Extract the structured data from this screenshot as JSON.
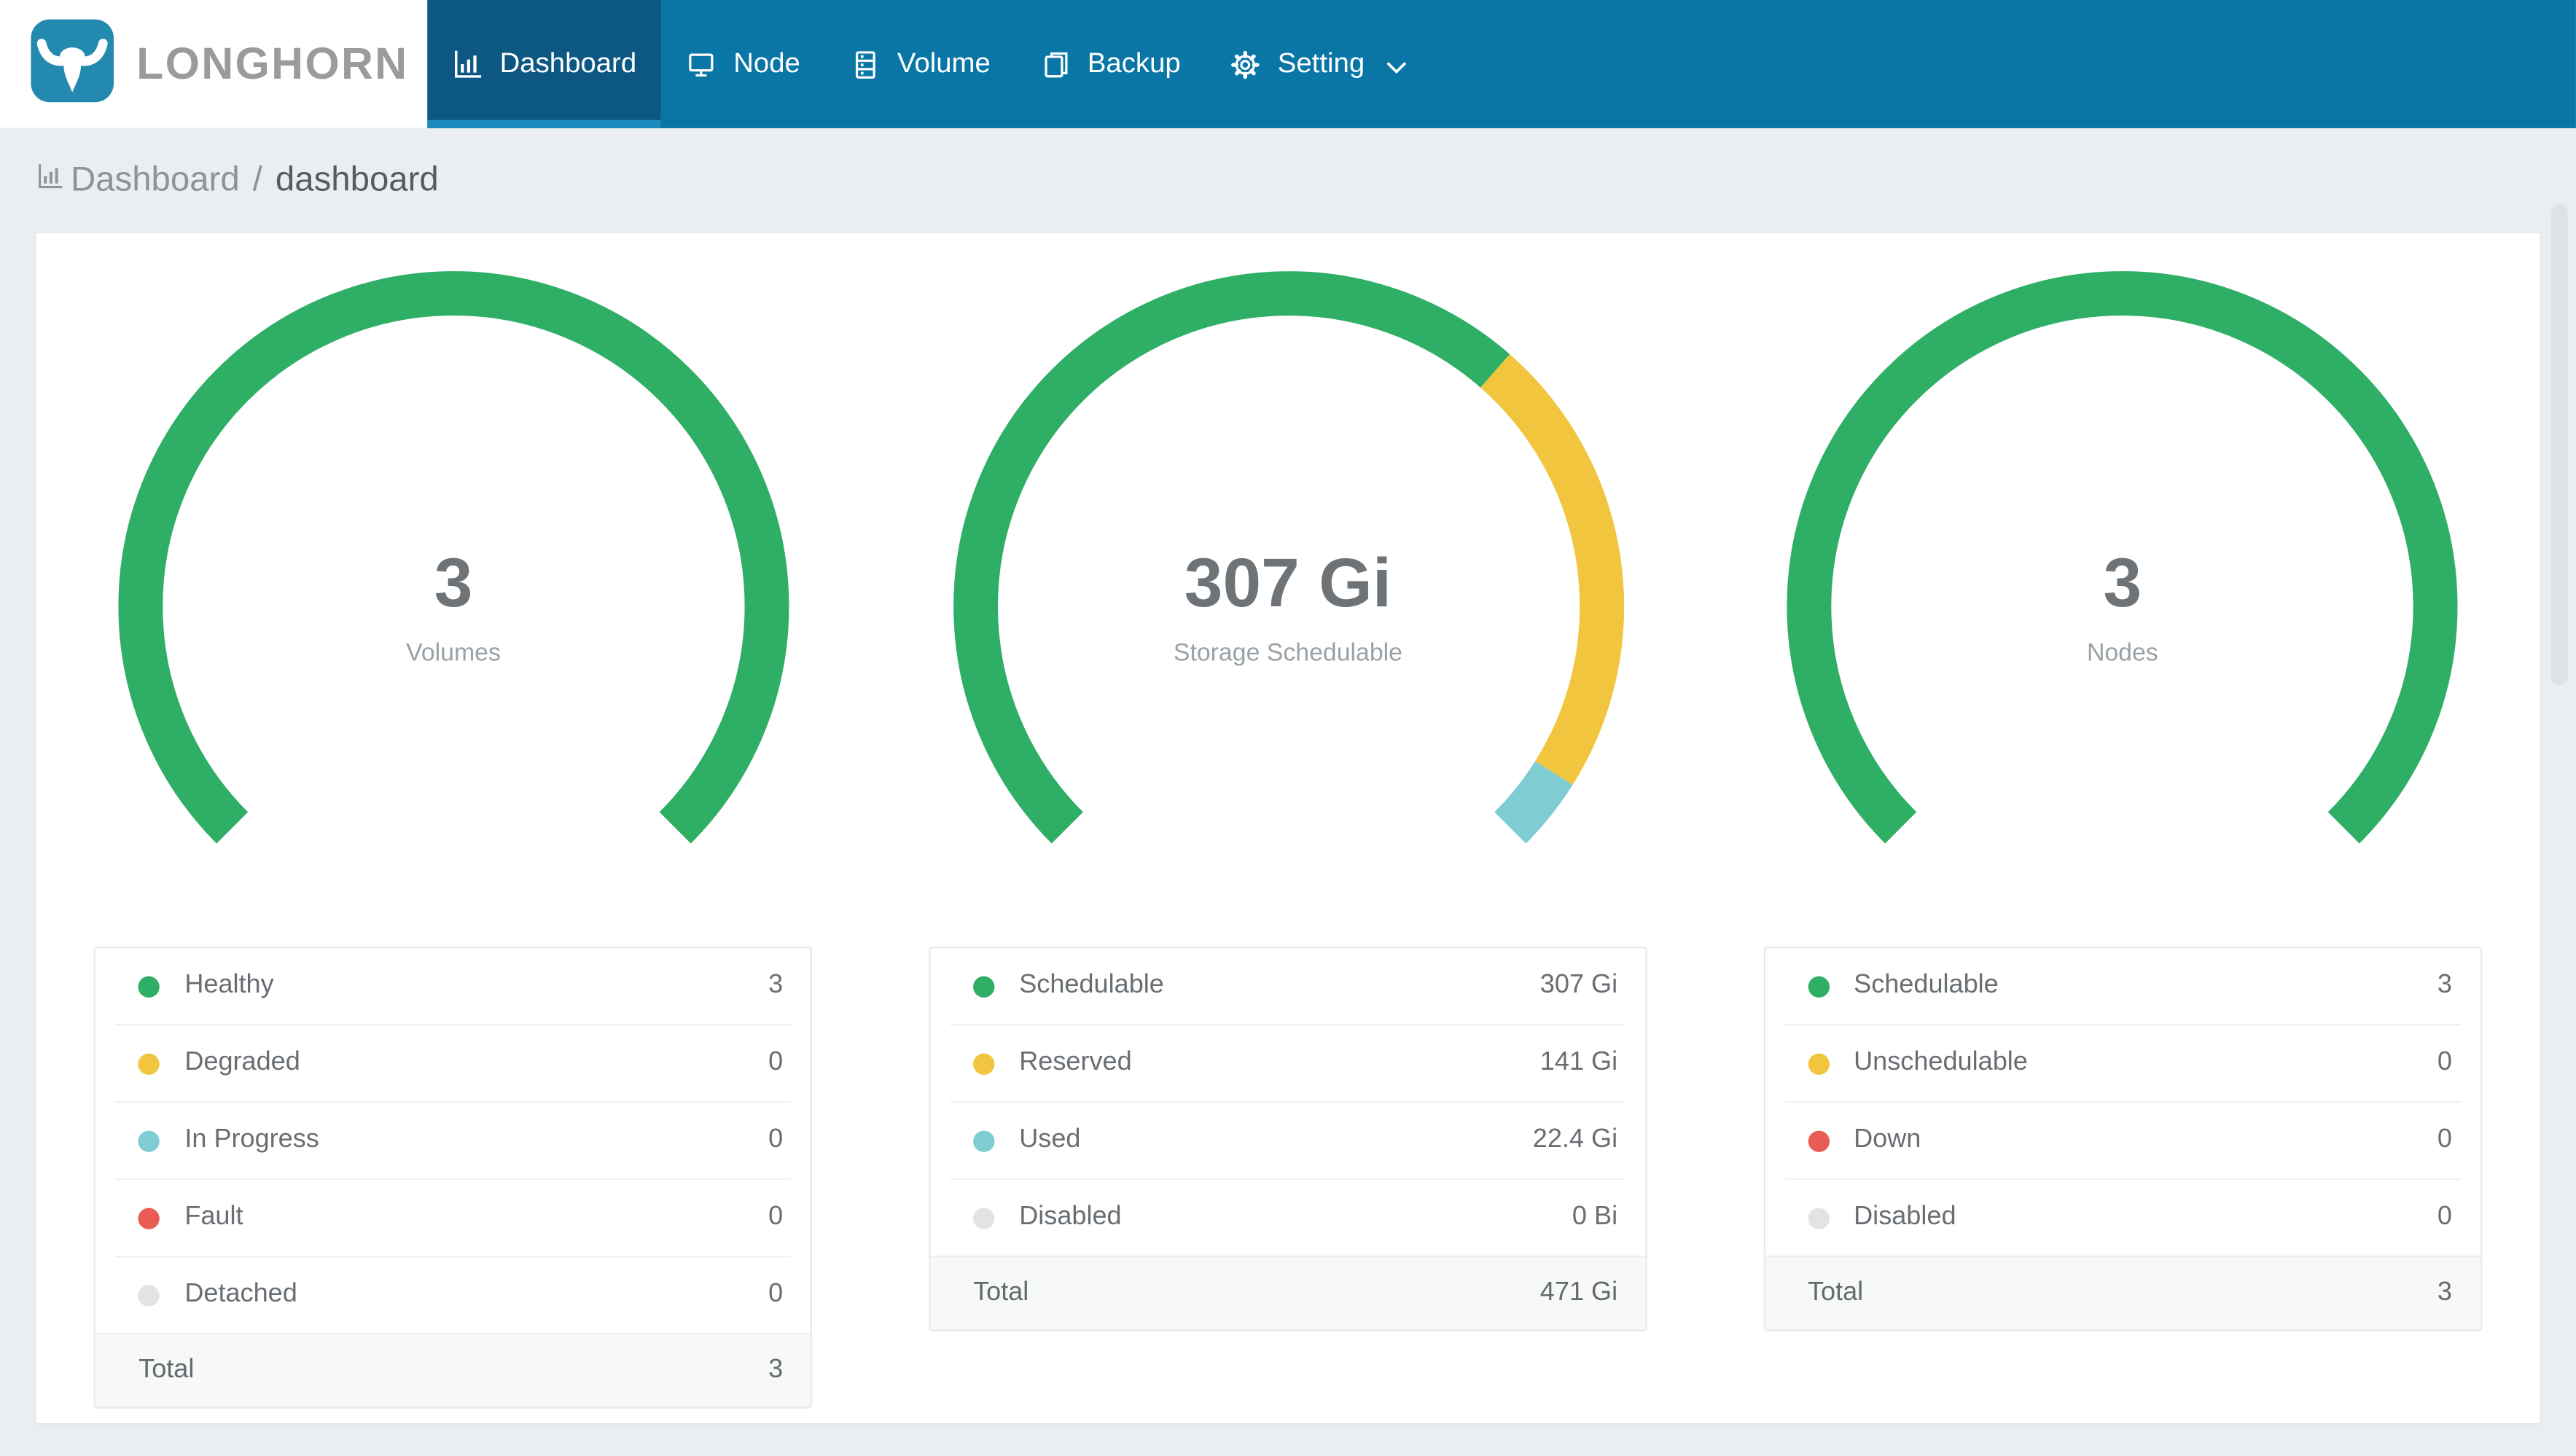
{
  "app": {
    "brand": "LONGHORN"
  },
  "nav": {
    "items": [
      {
        "label": "Dashboard",
        "icon": "dashboard-icon",
        "active": true
      },
      {
        "label": "Node",
        "icon": "node-icon",
        "active": false
      },
      {
        "label": "Volume",
        "icon": "volume-icon",
        "active": false
      },
      {
        "label": "Backup",
        "icon": "backup-icon",
        "active": false
      },
      {
        "label": "Setting",
        "icon": "setting-icon",
        "active": false,
        "dropdown": true
      }
    ]
  },
  "breadcrumb": {
    "root": "Dashboard",
    "separator": "/",
    "current": "dashboard"
  },
  "colors": {
    "navbar": "#0a76a6",
    "navbar_active_tab": "#0d5882",
    "navbar_active_underline": "#1b8cbd",
    "logo_square": "#2489ae",
    "brand_text": "#9b9b9b",
    "page_background": "#ebeef0",
    "card_background": "#ffffff",
    "green": "#2fae66",
    "yellow": "#f1c53e",
    "teal": "#7fccd2",
    "red": "#e95c55",
    "gray": "#e1e3e4"
  },
  "chart_data": [
    {
      "type": "gauge",
      "center_value": "3",
      "center_label": "Volumes",
      "start_angle": 225,
      "end_angle": -45,
      "rows": [
        {
          "label": "Healthy",
          "value": 3,
          "display": "3",
          "color": "#2fae66"
        },
        {
          "label": "Degraded",
          "value": 0,
          "display": "0",
          "color": "#f1c53e"
        },
        {
          "label": "In Progress",
          "value": 0,
          "display": "0",
          "color": "#7fccd2"
        },
        {
          "label": "Fault",
          "value": 0,
          "display": "0",
          "color": "#e95c55"
        },
        {
          "label": "Detached",
          "value": 0,
          "display": "0",
          "color": "#e1e3e4"
        }
      ],
      "total": {
        "label": "Total",
        "display": "3"
      }
    },
    {
      "type": "gauge",
      "center_value": "307 Gi",
      "center_label": "Storage Schedulable",
      "start_angle": 225,
      "end_angle": -45,
      "rows": [
        {
          "label": "Schedulable",
          "value": 307,
          "display": "307 Gi",
          "color": "#2fae66"
        },
        {
          "label": "Reserved",
          "value": 141,
          "display": "141 Gi",
          "color": "#f1c53e"
        },
        {
          "label": "Used",
          "value": 22.4,
          "display": "22.4 Gi",
          "color": "#7fccd2"
        },
        {
          "label": "Disabled",
          "value": 0,
          "display": "0 Bi",
          "color": "#e1e3e4"
        }
      ],
      "total": {
        "label": "Total",
        "display": "471 Gi"
      }
    },
    {
      "type": "gauge",
      "center_value": "3",
      "center_label": "Nodes",
      "start_angle": 225,
      "end_angle": -45,
      "rows": [
        {
          "label": "Schedulable",
          "value": 3,
          "display": "3",
          "color": "#2fae66"
        },
        {
          "label": "Unschedulable",
          "value": 0,
          "display": "0",
          "color": "#f1c53e"
        },
        {
          "label": "Down",
          "value": 0,
          "display": "0",
          "color": "#e95c55"
        },
        {
          "label": "Disabled",
          "value": 0,
          "display": "0",
          "color": "#e1e3e4"
        }
      ],
      "total": {
        "label": "Total",
        "display": "3"
      }
    }
  ]
}
